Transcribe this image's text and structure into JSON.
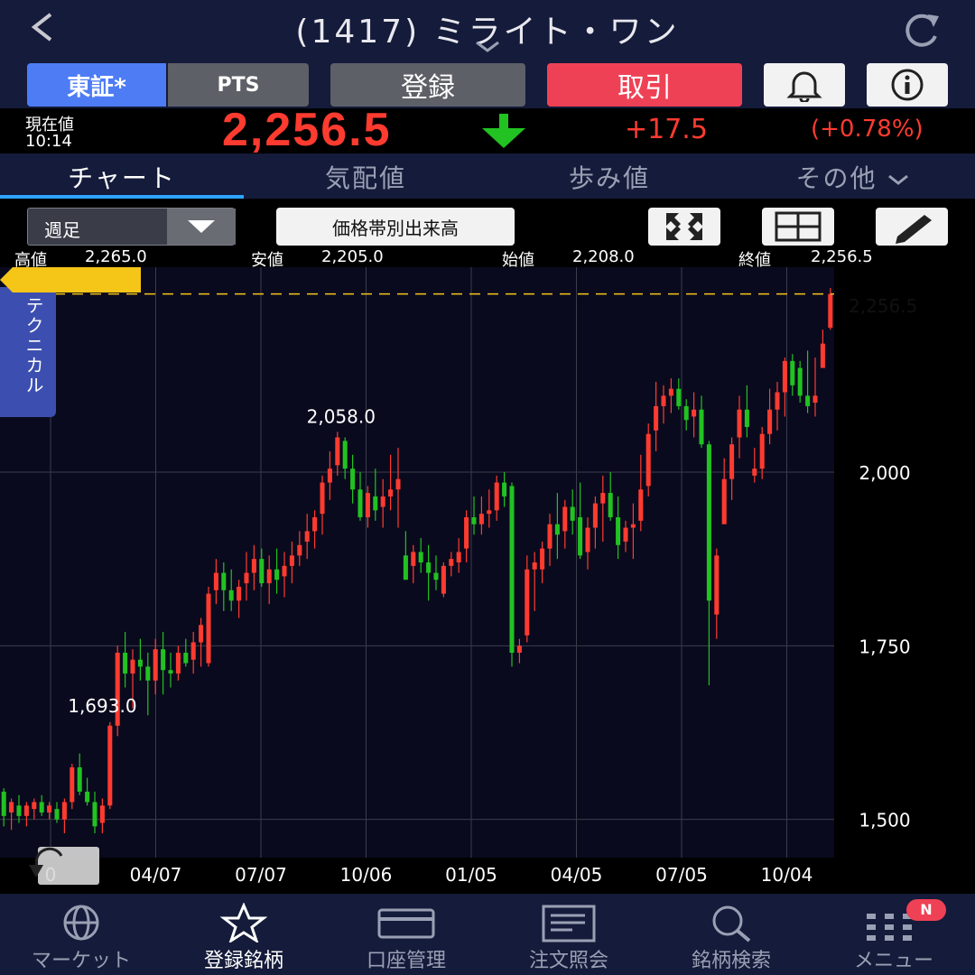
{
  "header": {
    "title": "(1417) ミライト・ワン"
  },
  "buttons": {
    "tosho": "東証*",
    "pts": "PTS",
    "register": "登録",
    "trade": "取引"
  },
  "price": {
    "label": "現在値",
    "time": "10:14",
    "value": "2,256.5",
    "change": "+17.5",
    "change_pct": "(+0.78%)"
  },
  "tabs": [
    "チャート",
    "気配値",
    "歩み値",
    "その他"
  ],
  "chart_toolbar": {
    "period": "週足",
    "volume_by_price": "価格帯別出来高"
  },
  "ohlc": [
    {
      "label": "高値",
      "value": "2,265.0"
    },
    {
      "label": "安値",
      "value": "2,205.0"
    },
    {
      "label": "始値",
      "value": "2,208.0"
    },
    {
      "label": "終値",
      "value": "2,256.5"
    }
  ],
  "technical_tab": "テクニカル",
  "colors": {
    "up": "#ff3b30",
    "down": "#21c221",
    "accent": "#4d7cf5",
    "trade": "#ef4155",
    "last_price_tag": "#f5c518"
  },
  "chart_data": {
    "type": "candlestick",
    "x_tick_labels": [
      "0",
      "04/07",
      "07/07",
      "10/06",
      "01/05",
      "04/05",
      "07/05",
      "10/04"
    ],
    "y_tick_labels": [
      "2,000",
      "1,750",
      "1,500"
    ],
    "y_ticks": [
      2000,
      1750,
      1500
    ],
    "ylim": [
      1445,
      2295
    ],
    "grid": true,
    "annotations": {
      "high": "2,058.0",
      "low": "1,693.0",
      "last": "2,256.5"
    },
    "high_value": 2058,
    "low_value": 1693,
    "last_value": 2256.5,
    "candles": [
      [
        1540,
        1545,
        1490,
        1505
      ],
      [
        1510,
        1530,
        1485,
        1525
      ],
      [
        1520,
        1535,
        1495,
        1505
      ],
      [
        1505,
        1525,
        1490,
        1520
      ],
      [
        1515,
        1530,
        1500,
        1525
      ],
      [
        1525,
        1535,
        1505,
        1510
      ],
      [
        1510,
        1525,
        1500,
        1520
      ],
      [
        1515,
        1525,
        1495,
        1500
      ],
      [
        1500,
        1530,
        1480,
        1525
      ],
      [
        1525,
        1580,
        1515,
        1575
      ],
      [
        1575,
        1595,
        1535,
        1540
      ],
      [
        1540,
        1560,
        1520,
        1525
      ],
      [
        1525,
        1540,
        1480,
        1490
      ],
      [
        1495,
        1530,
        1480,
        1520
      ],
      [
        1520,
        1640,
        1515,
        1635
      ],
      [
        1635,
        1750,
        1620,
        1740
      ],
      [
        1740,
        1770,
        1690,
        1710
      ],
      [
        1710,
        1745,
        1660,
        1730
      ],
      [
        1730,
        1760,
        1700,
        1720
      ],
      [
        1720,
        1740,
        1650,
        1700
      ],
      [
        1700,
        1760,
        1680,
        1745
      ],
      [
        1745,
        1770,
        1680,
        1715
      ],
      [
        1715,
        1740,
        1690,
        1710
      ],
      [
        1710,
        1750,
        1700,
        1740
      ],
      [
        1740,
        1760,
        1720,
        1725
      ],
      [
        1730,
        1770,
        1710,
        1755
      ],
      [
        1755,
        1790,
        1720,
        1780
      ],
      [
        1725,
        1835,
        1720,
        1825
      ],
      [
        1830,
        1875,
        1810,
        1855
      ],
      [
        1855,
        1870,
        1800,
        1830
      ],
      [
        1830,
        1860,
        1800,
        1815
      ],
      [
        1815,
        1845,
        1790,
        1835
      ],
      [
        1840,
        1885,
        1815,
        1855
      ],
      [
        1855,
        1895,
        1830,
        1875
      ],
      [
        1875,
        1890,
        1835,
        1840
      ],
      [
        1840,
        1880,
        1810,
        1860
      ],
      [
        1860,
        1890,
        1825,
        1845
      ],
      [
        1850,
        1885,
        1820,
        1865
      ],
      [
        1865,
        1900,
        1840,
        1880
      ],
      [
        1880,
        1915,
        1865,
        1895
      ],
      [
        1900,
        1940,
        1875,
        1915
      ],
      [
        1915,
        1945,
        1890,
        1935
      ],
      [
        1940,
        1995,
        1910,
        1985
      ],
      [
        1985,
        2030,
        1960,
        2005
      ],
      [
        2010,
        2058,
        1995,
        2050
      ],
      [
        2045,
        2050,
        1990,
        2005
      ],
      [
        2005,
        2025,
        1955,
        1975
      ],
      [
        1975,
        2000,
        1930,
        1935
      ],
      [
        1935,
        1980,
        1920,
        1970
      ],
      [
        1965,
        2005,
        1930,
        1945
      ],
      [
        1950,
        1990,
        1920,
        1965
      ],
      [
        1965,
        2025,
        1945,
        1975
      ],
      [
        1975,
        2035,
        1920,
        1990
      ],
      [
        1880,
        1915,
        1850,
        1845
      ],
      [
        1865,
        1895,
        1840,
        1885
      ],
      [
        1885,
        1905,
        1855,
        1870
      ],
      [
        1870,
        1895,
        1815,
        1855
      ],
      [
        1855,
        1880,
        1830,
        1845
      ],
      [
        1825,
        1870,
        1820,
        1865
      ],
      [
        1865,
        1885,
        1850,
        1875
      ],
      [
        1870,
        1905,
        1855,
        1885
      ],
      [
        1890,
        1945,
        1870,
        1935
      ],
      [
        1935,
        1965,
        1910,
        1925
      ],
      [
        1925,
        1965,
        1910,
        1940
      ],
      [
        1940,
        1975,
        1920,
        1945
      ],
      [
        1945,
        1995,
        1930,
        1985
      ],
      [
        1985,
        2000,
        1950,
        1965
      ],
      [
        1980,
        1985,
        1720,
        1740
      ],
      [
        1740,
        1760,
        1725,
        1750
      ],
      [
        1765,
        1880,
        1755,
        1860
      ],
      [
        1860,
        1885,
        1800,
        1870
      ],
      [
        1860,
        1900,
        1840,
        1890
      ],
      [
        1890,
        1940,
        1865,
        1925
      ],
      [
        1925,
        1970,
        1875,
        1910
      ],
      [
        1915,
        1960,
        1890,
        1950
      ],
      [
        1950,
        1975,
        1910,
        1930
      ],
      [
        1935,
        1985,
        1875,
        1880
      ],
      [
        1885,
        1935,
        1860,
        1920
      ],
      [
        1920,
        1965,
        1890,
        1955
      ],
      [
        1955,
        1995,
        1900,
        1970
      ],
      [
        1970,
        2000,
        1930,
        1935
      ],
      [
        1935,
        1965,
        1875,
        1895
      ],
      [
        1900,
        1930,
        1885,
        1920
      ],
      [
        1920,
        1955,
        1875,
        1925
      ],
      [
        1930,
        2025,
        1915,
        1975
      ],
      [
        1980,
        2070,
        1965,
        2055
      ],
      [
        2060,
        2130,
        2030,
        2095
      ],
      [
        2095,
        2125,
        2070,
        2110
      ],
      [
        2110,
        2135,
        2085,
        2120
      ],
      [
        2120,
        2135,
        2090,
        2095
      ],
      [
        2095,
        2105,
        2060,
        2075
      ],
      [
        2080,
        2115,
        2050,
        2090
      ],
      [
        2090,
        2110,
        2035,
        2040
      ],
      [
        2040,
        2045,
        1693,
        1815
      ],
      [
        1795,
        1890,
        1760,
        1880
      ],
      [
        1925,
        2020,
        1960,
        1990
      ],
      [
        1990,
        2050,
        1960,
        2040
      ],
      [
        2050,
        2110,
        2020,
        2090
      ],
      [
        2090,
        2125,
        2050,
        2065
      ],
      [
        1995,
        2035,
        1985,
        2005
      ],
      [
        2005,
        2065,
        1990,
        2055
      ],
      [
        2055,
        2120,
        2040,
        2090
      ],
      [
        2090,
        2130,
        2060,
        2115
      ],
      [
        2115,
        2165,
        2080,
        2160
      ],
      [
        2160,
        2170,
        2110,
        2125
      ],
      [
        2150,
        2160,
        2100,
        2110
      ],
      [
        2110,
        2175,
        2085,
        2095
      ],
      [
        2100,
        2165,
        2080,
        2110
      ],
      [
        2150,
        2205,
        2160,
        2185
      ],
      [
        2208,
        2265,
        2205,
        2256.5
      ]
    ]
  },
  "nav": [
    {
      "label": "マーケット",
      "icon": "globe-icon"
    },
    {
      "label": "登録銘柄",
      "icon": "star-icon"
    },
    {
      "label": "口座管理",
      "icon": "card-icon"
    },
    {
      "label": "注文照会",
      "icon": "document-icon"
    },
    {
      "label": "銘柄検索",
      "icon": "search-icon"
    },
    {
      "label": "メニュー",
      "icon": "menu-icon"
    }
  ],
  "menu_badge": "N"
}
